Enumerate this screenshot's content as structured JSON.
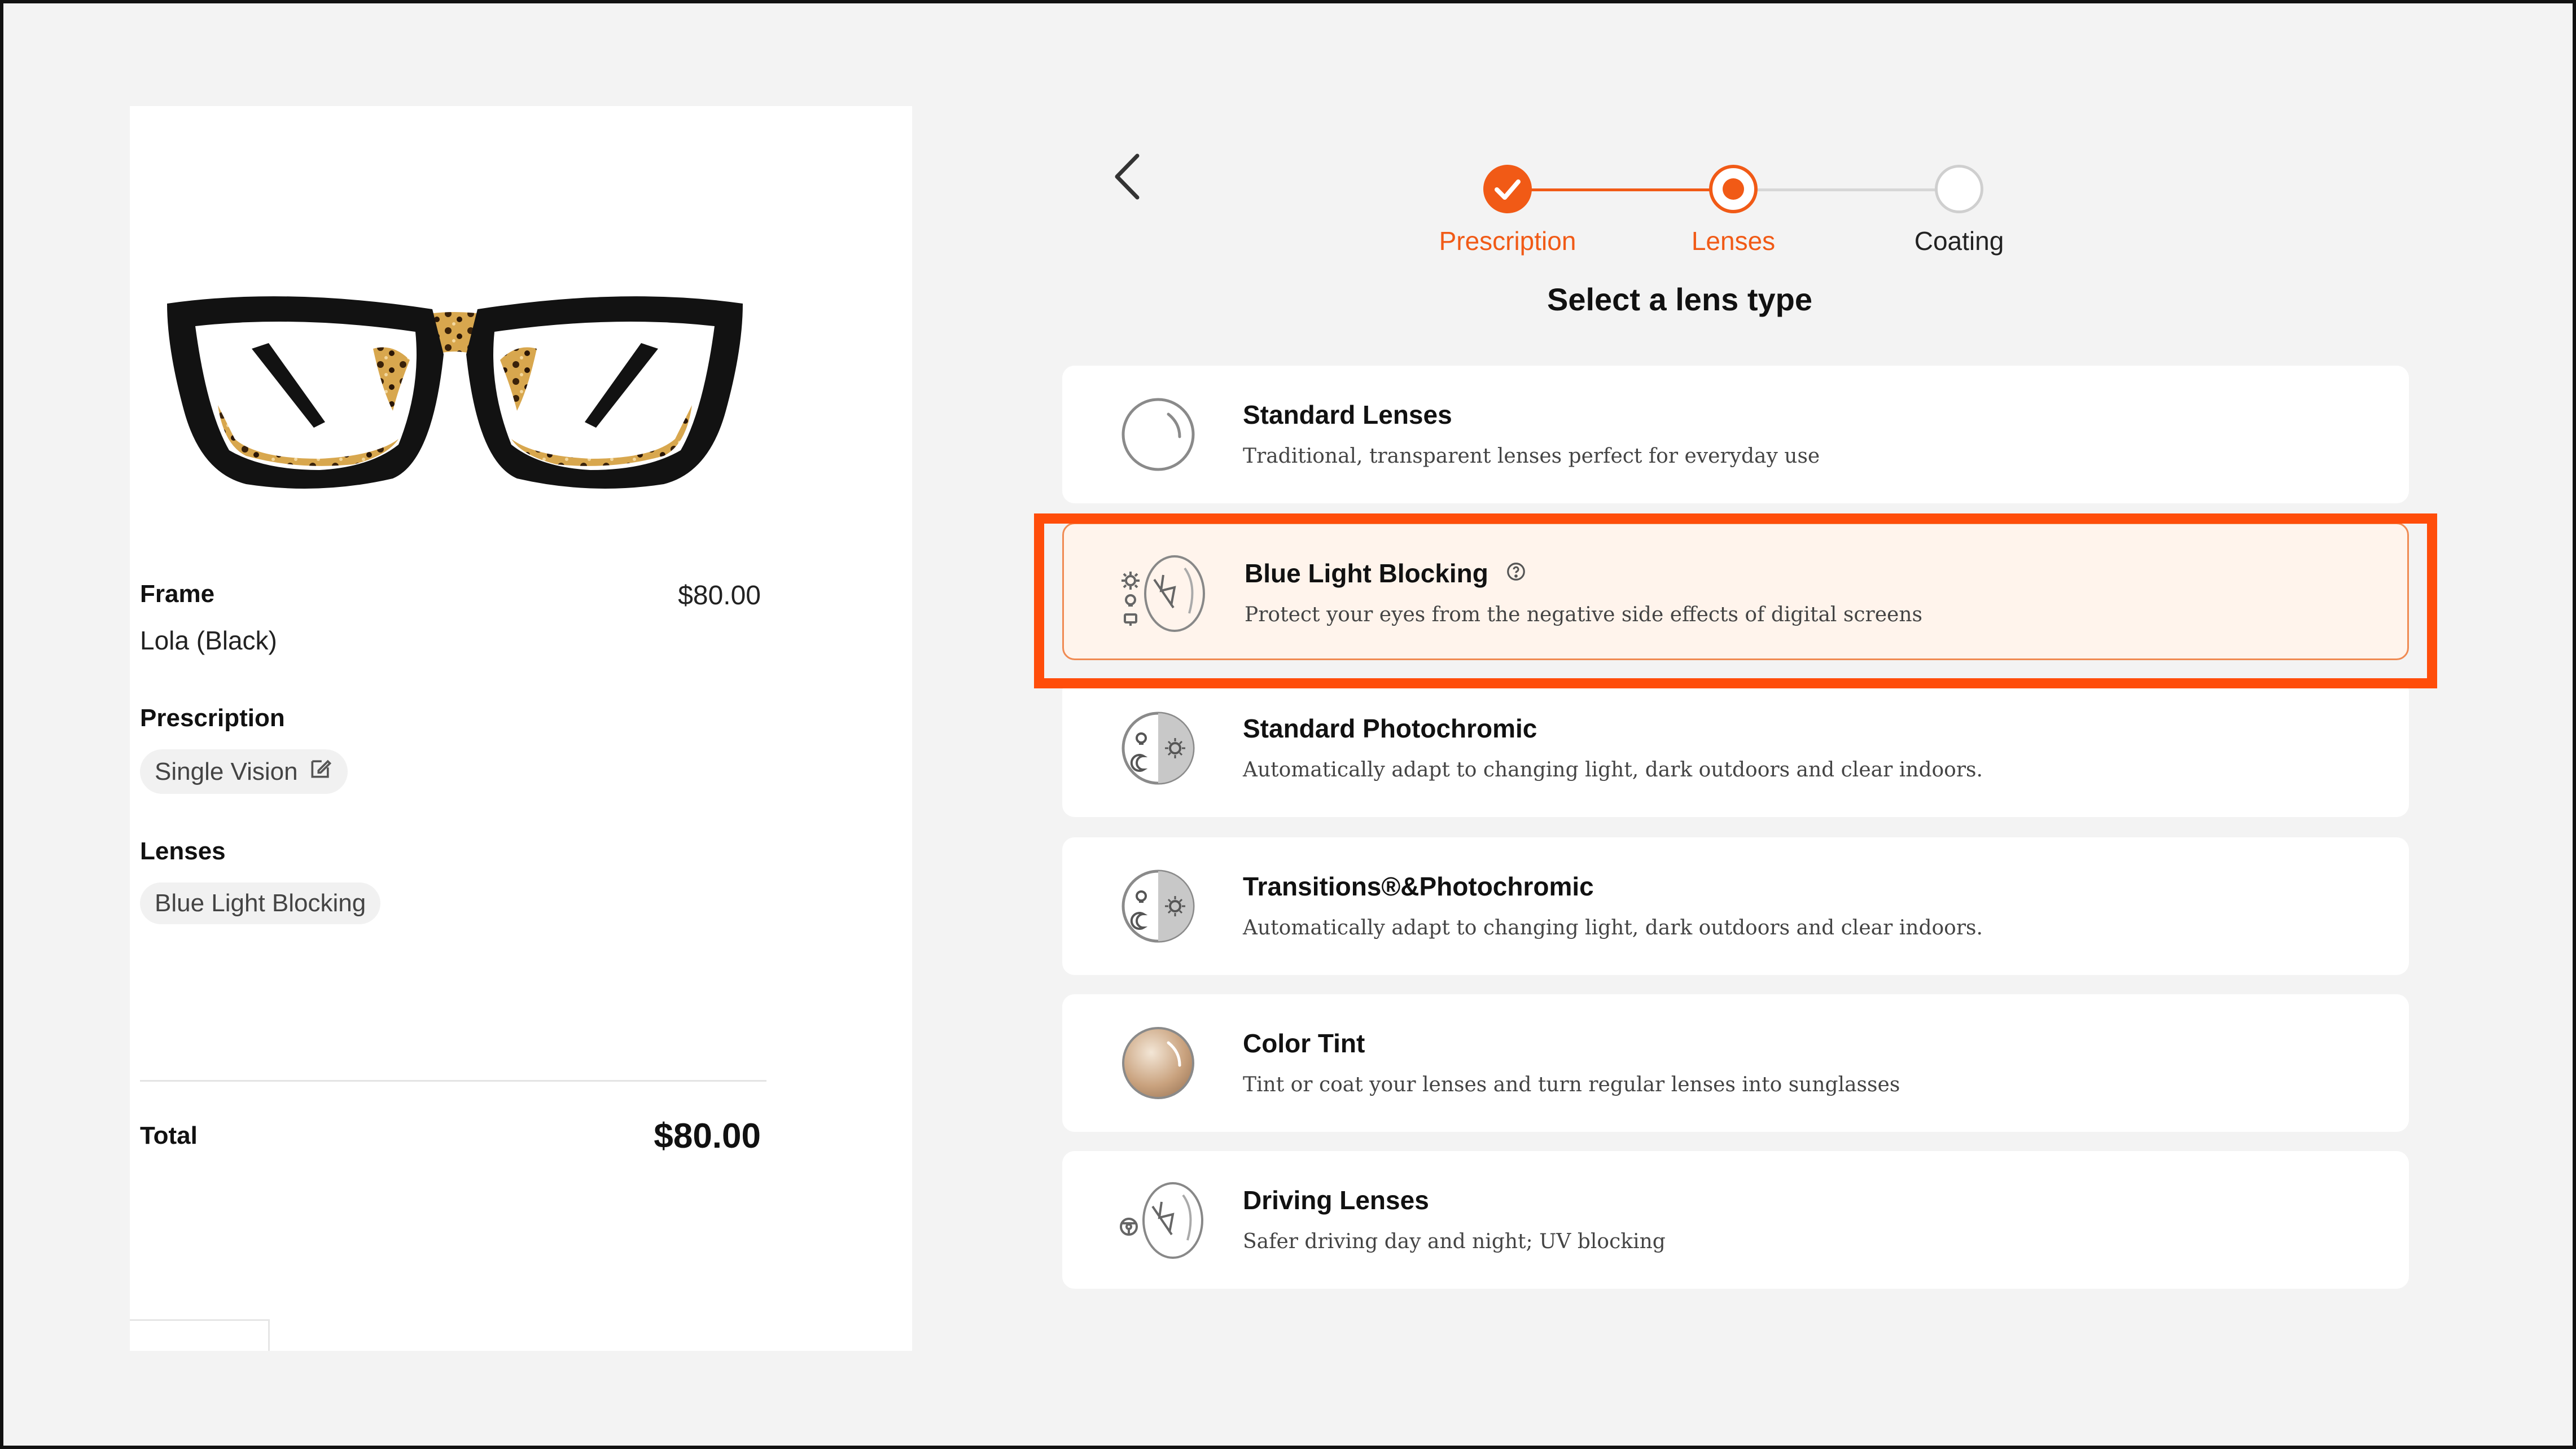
{
  "summary": {
    "frame_label": "Frame",
    "frame_price": "$80.00",
    "frame_name": "Lola (Black)",
    "prescription_label": "Prescription",
    "prescription_value": "Single Vision",
    "lenses_label": "Lenses",
    "lenses_value": "Blue Light Blocking",
    "total_label": "Total",
    "total_price": "$80.00"
  },
  "stepper": {
    "steps": [
      {
        "label": "Prescription",
        "state": "done"
      },
      {
        "label": "Lenses",
        "state": "current"
      },
      {
        "label": "Coating",
        "state": "upcoming"
      }
    ]
  },
  "title": "Select a lens type",
  "lenses": [
    {
      "name": "Standard Lenses",
      "desc": "Traditional, transparent lenses perfect for everyday use",
      "icon": "clear-lens-icon"
    },
    {
      "name": "Blue Light Blocking",
      "desc": "Protect your eyes from the negative side effects of digital screens",
      "icon": "blue-light-lens-icon",
      "selected": true,
      "info_icon": "help-circle-icon"
    },
    {
      "name": "Standard Photochromic",
      "desc": "Automatically adapt to changing light, dark outdoors and clear indoors.",
      "icon": "photochromic-lens-icon"
    },
    {
      "name": "Transitions®&Photochromic",
      "desc": "Automatically adapt to changing light, dark outdoors and clear indoors.",
      "icon": "transitions-lens-icon"
    },
    {
      "name": "Color Tint",
      "desc": "Tint or coat your lenses and turn regular lenses into sunglasses",
      "icon": "tinted-lens-icon"
    },
    {
      "name": "Driving Lenses",
      "desc": "Safer driving day and night; UV blocking",
      "icon": "driving-lens-icon"
    }
  ],
  "colors": {
    "accent": "#f15a16",
    "highlight": "#ff4d0a",
    "selected_bg": "#fff4ec"
  }
}
